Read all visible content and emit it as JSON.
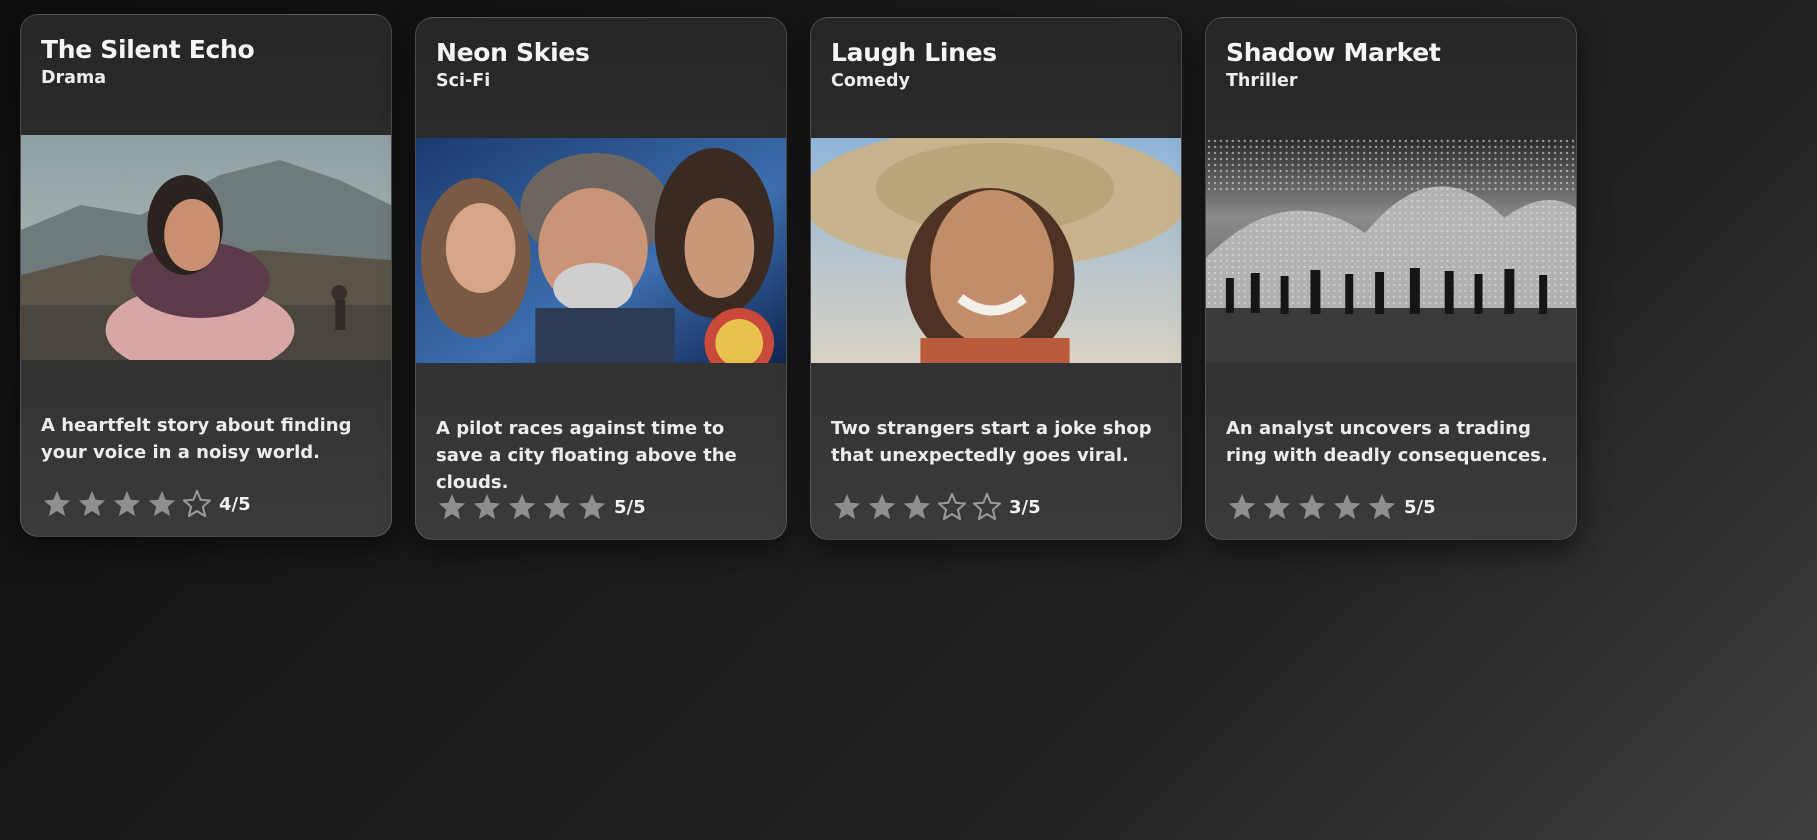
{
  "cards": [
    {
      "title": "The Silent Echo",
      "genre": "Drama",
      "poster_icon": "poster-image",
      "poster_text": "The Silent Echo",
      "description": "A heartfelt story about finding your voice in a noisy world.",
      "rating": 4,
      "rating_max": 5,
      "rating_text": "4/5"
    },
    {
      "title": "Neon Skies",
      "genre": "Sci-Fi",
      "poster_icon": "poster-image",
      "description": "A pilot races against time to save a city floating above the clouds.",
      "rating": 5,
      "rating_max": 5,
      "rating_text": "5/5"
    },
    {
      "title": "Laugh Lines",
      "genre": "Comedy",
      "poster_icon": "poster-image",
      "description": "Two strangers start a joke shop that unexpectedly goes viral.",
      "rating": 3,
      "rating_max": 5,
      "rating_text": "3/5"
    },
    {
      "title": "Shadow Market",
      "genre": "Thriller",
      "poster_icon": "poster-image",
      "description": "An analyst uncovers a trading ring with deadly consequences.",
      "rating": 5,
      "rating_max": 5,
      "rating_text": "5/5"
    }
  ],
  "colors": {
    "star_filled": "#8f8f8f",
    "star_empty_stroke": "#9a9a9a",
    "card_border": "#4a4a4a"
  },
  "icons": {
    "star_filled": "star-filled-icon",
    "star_empty": "star-empty-icon"
  }
}
